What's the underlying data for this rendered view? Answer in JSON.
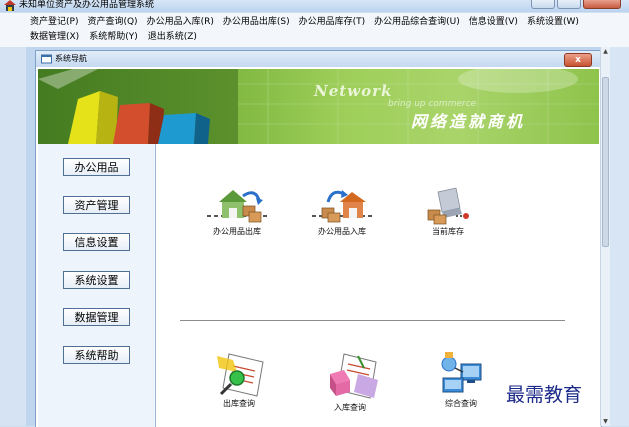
{
  "window": {
    "title": "未知单位资产及办公用品管理系统",
    "controls": [
      "minimize-button",
      "maximize-button",
      "close-button"
    ]
  },
  "menubar": {
    "row1": [
      "资产登记(P)",
      "资产查询(Q)",
      "办公用品入库(R)",
      "办公用品出库(S)",
      "办公用品库存(T)",
      "办公用品综合查询(U)",
      "信息设置(V)",
      "系统设置(W)"
    ],
    "row2": [
      "数据管理(X)",
      "系统帮助(Y)",
      "退出系统(Z)"
    ]
  },
  "child_window": {
    "title": "系统导航",
    "close_label": "x"
  },
  "banner": {
    "brand_text": "Network",
    "sub_text": "bring up commerce",
    "cn_text": "网络造就商机"
  },
  "sidebar": {
    "items": [
      "办公用品",
      "资产管理",
      "信息设置",
      "系统设置",
      "数据管理",
      "系统帮助"
    ]
  },
  "content": {
    "top_tiles": [
      {
        "label": "办公用品出库",
        "icon": "warehouse-out-icon"
      },
      {
        "label": "办公用品入库",
        "icon": "warehouse-in-icon"
      },
      {
        "label": "当前库存",
        "icon": "inventory-icon"
      }
    ],
    "bottom_tiles": [
      {
        "label": "出库查询",
        "icon": "search-document-icon"
      },
      {
        "label": "入库查询",
        "icon": "package-document-icon"
      },
      {
        "label": "综合查询",
        "icon": "network-computer-icon"
      }
    ]
  },
  "watermark": "最需教育",
  "colors": {
    "banner_green": "#78b33b",
    "menubar_bg": "#f3f6fa",
    "mdi_bg": "#bfd6ee",
    "watermark": "#1c2a8a"
  }
}
